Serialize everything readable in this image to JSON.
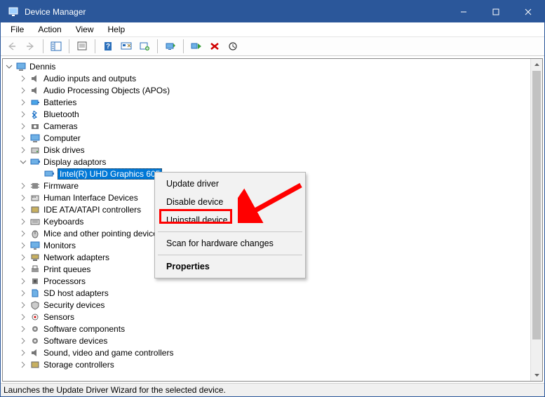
{
  "titlebar": {
    "title": "Device Manager"
  },
  "menubar": {
    "file": "File",
    "action": "Action",
    "view": "View",
    "help": "Help"
  },
  "tree": {
    "root": "Dennis",
    "audio_io": "Audio inputs and outputs",
    "audio_apos": "Audio Processing Objects (APOs)",
    "batteries": "Batteries",
    "bluetooth": "Bluetooth",
    "cameras": "Cameras",
    "computer": "Computer",
    "disk_drives": "Disk drives",
    "display_adaptors": "Display adaptors",
    "intel_uhd": "Intel(R) UHD Graphics 605",
    "firmware": "Firmware",
    "hid": "Human Interface Devices",
    "ide": "IDE ATA/ATAPI controllers",
    "keyboards": "Keyboards",
    "mice": "Mice and other pointing devices",
    "monitors": "Monitors",
    "network_adapters": "Network adapters",
    "print_queues": "Print queues",
    "processors": "Processors",
    "sd_host": "SD host adapters",
    "security_devices": "Security devices",
    "sensors": "Sensors",
    "software_components": "Software components",
    "software_devices": "Software devices",
    "svgc": "Sound, video and game controllers",
    "storage_controllers": "Storage controllers"
  },
  "context_menu": {
    "update_driver": "Update driver",
    "disable_device": "Disable device",
    "uninstall_device": "Uninstall device",
    "scan_hw": "Scan for hardware changes",
    "properties": "Properties"
  },
  "statusbar": {
    "text": "Launches the Update Driver Wizard for the selected device."
  }
}
